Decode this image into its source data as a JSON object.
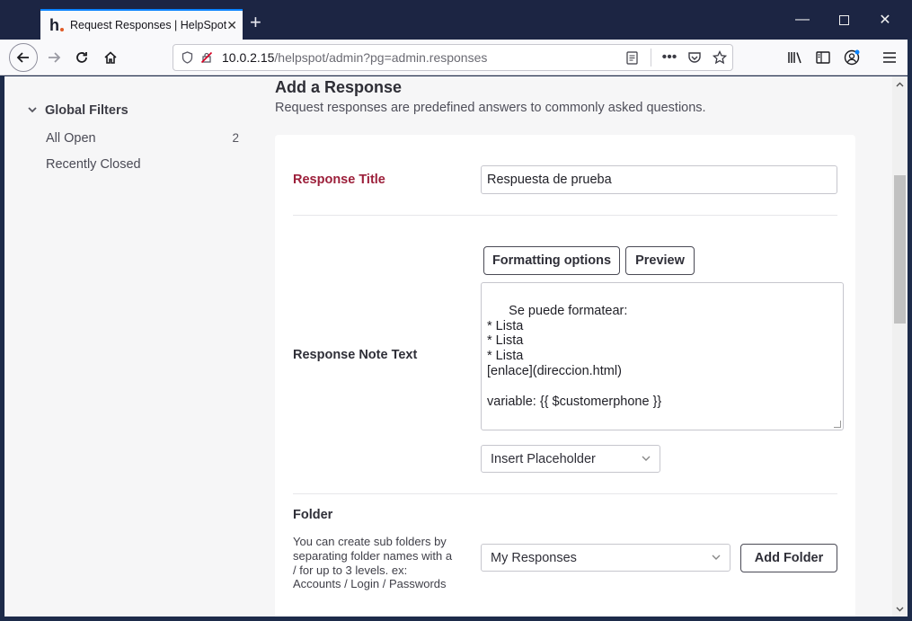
{
  "browser": {
    "tab_title": "Request Responses | HelpSpot",
    "favicon_letter": "h",
    "url_host": "10.0.2.15",
    "url_path": "/helpspot/admin?pg=admin.responses"
  },
  "sidebar": {
    "header": "Global Filters",
    "items": [
      {
        "label": "All Open",
        "count": "2"
      },
      {
        "label": "Recently Closed",
        "count": ""
      }
    ]
  },
  "main": {
    "title": "Add a Response",
    "description": "Request responses are predefined answers to commonly asked questions.",
    "response_title_label": "Response Title",
    "response_title_value": "Respuesta de prueba",
    "note_label": "Response Note Text",
    "formatting_button": "Formatting options",
    "preview_button": "Preview",
    "note_text": "Se puede formatear:\n* Lista\n* Lista\n* Lista\n[enlace](direccion.html)\n\nvariable: {{ $customerphone }}",
    "insert_placeholder": "Insert Placeholder",
    "folder_label": "Folder",
    "folder_help": "You can create sub folders by separating folder names with a / for up to 3 levels. ex: Accounts / Login / Passwords",
    "folder_value": "My Responses",
    "add_folder_button": "Add Folder"
  },
  "colors": {
    "required_label": "#9c1f3a",
    "titlebar": "#1c2543",
    "tab_accent": "#0a84ff"
  }
}
